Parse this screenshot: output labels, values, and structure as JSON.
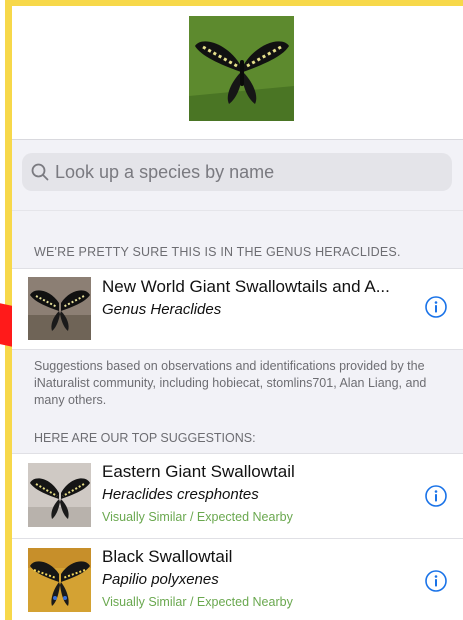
{
  "search": {
    "placeholder": "Look up a species by name"
  },
  "genus_section": {
    "header": "WE'RE PRETTY SURE THIS IS IN THE GENUS HERACLIDES.",
    "item": {
      "title": "New World Giant Swallowtails and A...",
      "subtitle": "Genus Heraclides"
    },
    "note": "Suggestions based on observations and identifications provided by the iNaturalist community, including hobiecat, stomlins701, Alan Liang, and many others."
  },
  "top_suggestions": {
    "header": "HERE ARE OUR TOP SUGGESTIONS:",
    "items": [
      {
        "title": "Eastern Giant Swallowtail",
        "subtitle": "Heraclides cresphontes",
        "tag": "Visually Similar / Expected Nearby"
      },
      {
        "title": "Black Swallowtail",
        "subtitle": "Papilio polyxenes",
        "tag": "Visually Similar / Expected Nearby"
      }
    ]
  },
  "colors": {
    "accent": "#1a73e8",
    "tag_green": "#6aa84f",
    "frame_yellow": "#f7d84a",
    "marker_red": "#ff1a1a"
  },
  "icons": {
    "search": "search-icon",
    "info": "info-icon"
  }
}
